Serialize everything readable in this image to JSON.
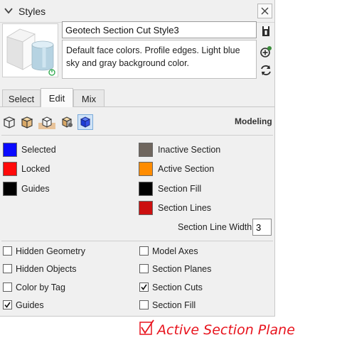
{
  "window": {
    "title": "Styles",
    "close_icon": "close-icon",
    "collapse_icon": "chevron-down-icon"
  },
  "style": {
    "name": "Geotech Section Cut Style3",
    "description": "Default face colors. Profile edges. Light blue sky and gray background color."
  },
  "side_icons": [
    "create-new-style-icon",
    "update-style-icon",
    "refresh-icon"
  ],
  "tabs": [
    {
      "label": "Select",
      "active": false
    },
    {
      "label": "Edit",
      "active": true
    },
    {
      "label": "Mix",
      "active": false
    }
  ],
  "toolbar": {
    "icons": [
      "edge-settings-icon",
      "face-settings-icon",
      "background-settings-icon",
      "watermark-settings-icon",
      "modeling-settings-icon"
    ],
    "selected_index": 4,
    "section_label": "Modeling"
  },
  "colors": {
    "left": [
      {
        "label": "Selected",
        "color": "#0a0aff"
      },
      {
        "label": "Locked",
        "color": "#ff0a0a"
      },
      {
        "label": "Guides",
        "color": "#000000"
      }
    ],
    "right": [
      {
        "label": "Inactive Section",
        "color": "#6f665e"
      },
      {
        "label": "Active Section",
        "color": "#ff8c00"
      },
      {
        "label": "Section Fill",
        "color": "#000000"
      },
      {
        "label": "Section Lines",
        "color": "#cc1010"
      }
    ]
  },
  "section_line_width": {
    "label": "Section Line Width",
    "value": "3"
  },
  "checkboxes": {
    "left": [
      {
        "label": "Hidden Geometry",
        "checked": false
      },
      {
        "label": "Hidden Objects",
        "checked": false
      },
      {
        "label": "Color by Tag",
        "checked": false
      },
      {
        "label": "Guides",
        "checked": true
      }
    ],
    "right": [
      {
        "label": "Model Axes",
        "checked": false
      },
      {
        "label": "Section Planes",
        "checked": false
      },
      {
        "label": "Section Cuts",
        "checked": true
      },
      {
        "label": "Section Fill",
        "checked": false
      }
    ]
  },
  "annotation": {
    "text": "Active Section Plane",
    "checked": true,
    "color": "#e8141e"
  }
}
